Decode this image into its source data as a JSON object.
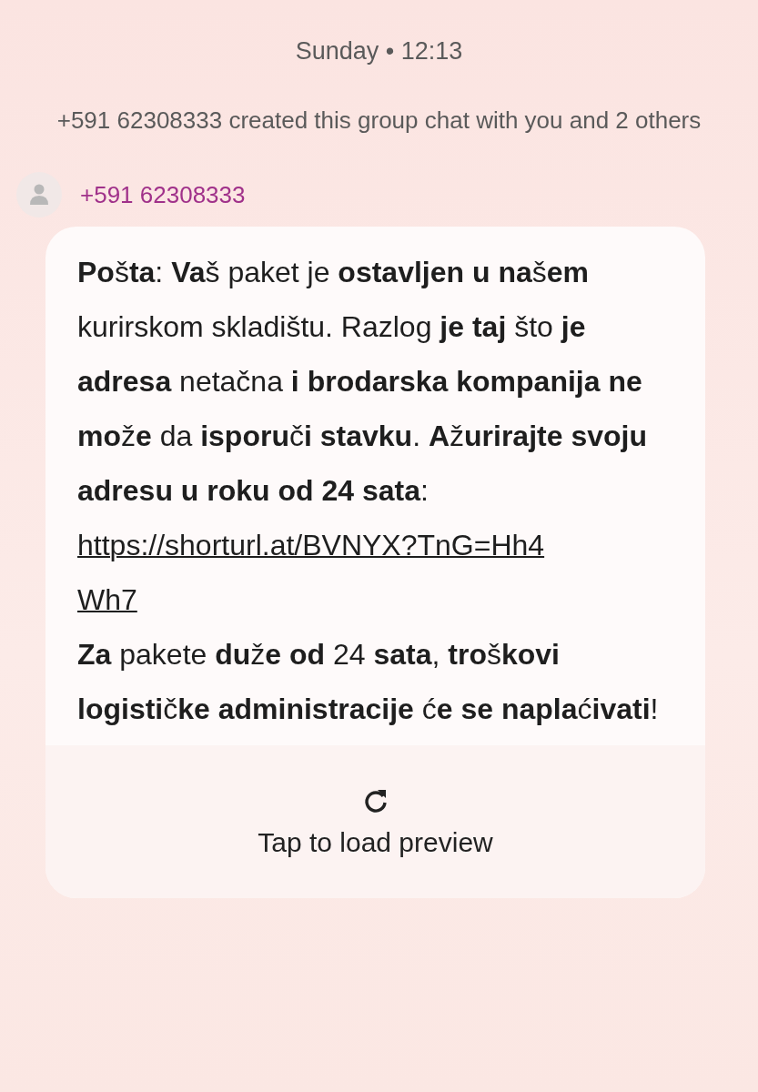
{
  "header": {
    "timestamp": "Sunday • 12:13",
    "system_notice": "+591 62308333 created this group chat with you and 2 others"
  },
  "message": {
    "sender": "+591 62308333",
    "text_before_link": "**Po**š**ta**: **Va**š paket je **ostavljen u na**š**em** kurirskom skladištu. Razlog **je taj** što **je adresa** netačna **i brodarska kompanija ne mo**ž**e** da **isporu**č**i stavku**. **A**ž**urirajte svoju adresu u roku od 24 sata**:",
    "link": "https://shorturl.at/BVNYX?TnG=Hh4Wh7",
    "text_after_link": "**Za** pakete **du**ž**e od** 24 **sata**, **tro**š**kovi logisti**č**ke administracije** ć**e se napla**ć**ivati**!",
    "preview_action": "Tap to load preview"
  }
}
